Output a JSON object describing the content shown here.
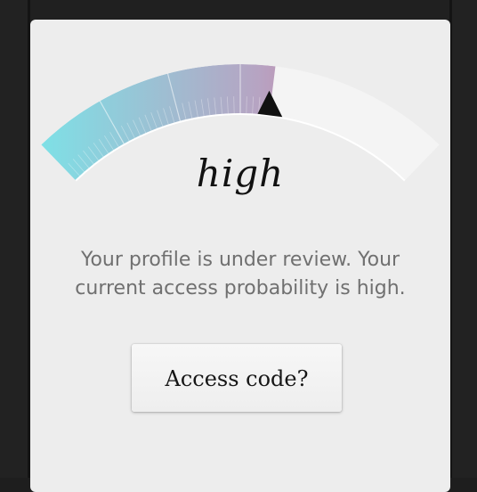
{
  "gauge": {
    "level_label": "high",
    "fill_fraction": 0.58,
    "colors": {
      "start": "#7ee0e6",
      "mid": "#b7a3c2",
      "end": "#e2557a",
      "track": "#f4f4f4",
      "needle": "#111111"
    }
  },
  "status": {
    "message": "Your profile is under review. Your current access probability is high."
  },
  "actions": {
    "access_code_label": "Access code?"
  }
}
